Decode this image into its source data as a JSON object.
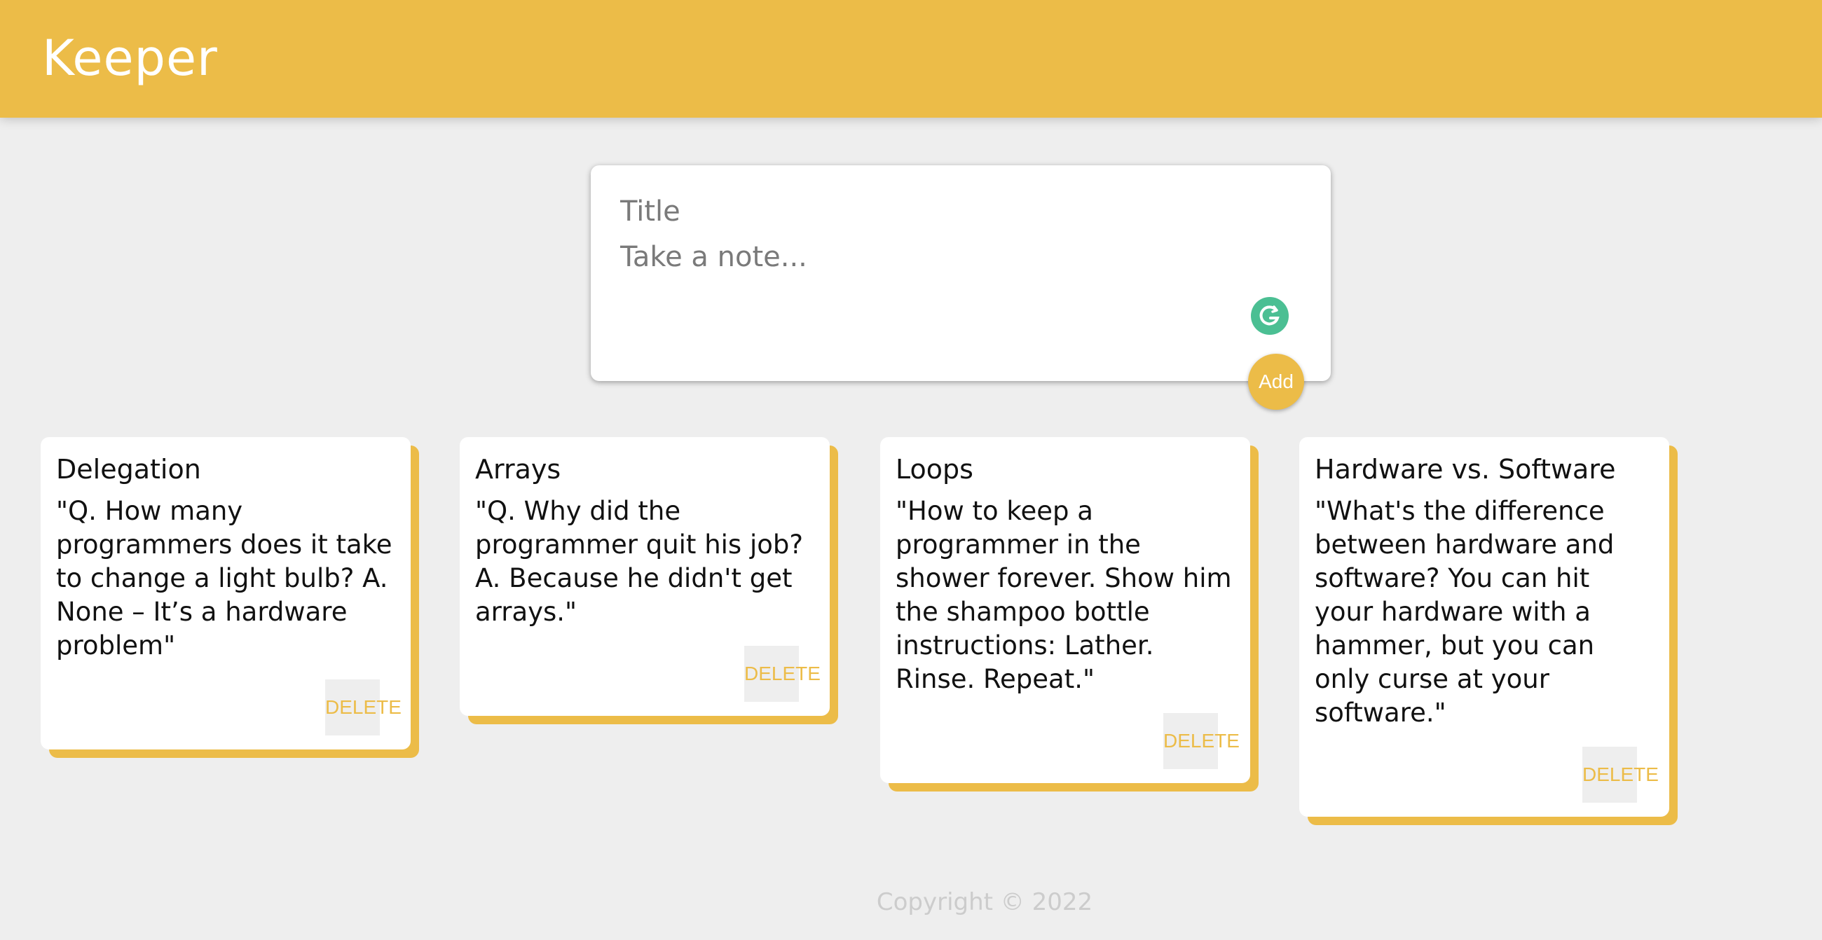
{
  "app": {
    "title": "Keeper"
  },
  "composer": {
    "title_placeholder": "Title",
    "content_placeholder": "Take a note...",
    "add_label": "Add"
  },
  "notes": [
    {
      "title": "Delegation",
      "content": "\"Q. How many programmers does it take to change a light bulb? A. None – It’s a hardware problem\"",
      "delete_label": "DELETE"
    },
    {
      "title": "Arrays",
      "content": "\"Q. Why did the programmer quit his job? A. Because he didn't get arrays.\"",
      "delete_label": "DELETE"
    },
    {
      "title": "Loops",
      "content": "\"How to keep a programmer in the shower forever. Show him the shampoo bottle instructions: Lather. Rinse. Repeat.\"",
      "delete_label": "DELETE"
    },
    {
      "title": "Hardware vs. Software",
      "content": "\"What's the difference between hardware and software? You can hit your hardware with a hammer, but you can only curse at your software.\"",
      "delete_label": "DELETE"
    }
  ],
  "footer": {
    "text": "Copyright © 2022"
  },
  "icons": {
    "grammarly": "grammarly-icon"
  },
  "colors": {
    "accent": "#ecbc48",
    "background": "#eeeeee",
    "grammarly": "#4bbf93"
  }
}
